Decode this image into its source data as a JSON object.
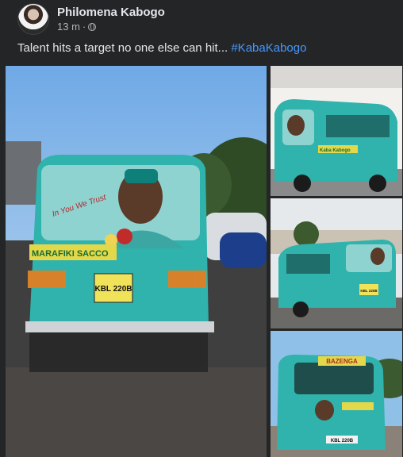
{
  "post": {
    "author": "Philomena Kabogo",
    "time": "13 m",
    "separator": "·",
    "caption_text": "Talent hits a target no one else can hit... ",
    "hashtag": "#KabaKabogo"
  },
  "photos": {
    "main": {
      "plate": "KBL 220B",
      "banner_text": "MARAFIKI SACCO",
      "slogan": "In You We Trust"
    },
    "thumb_top": {
      "banner_text": "Kaba Kabogo"
    },
    "thumb_middle": {
      "plate": "KBL 220B"
    },
    "thumb_bottom": {
      "top_banner": "BAZENGA",
      "plate": "KBL 220B"
    }
  },
  "colors": {
    "background": "#242526",
    "hashtag": "#4599ff",
    "matatu_teal": "#2fb3ac",
    "banner_yellow": "#e3d84a"
  },
  "icons": [
    "globe-icon"
  ]
}
